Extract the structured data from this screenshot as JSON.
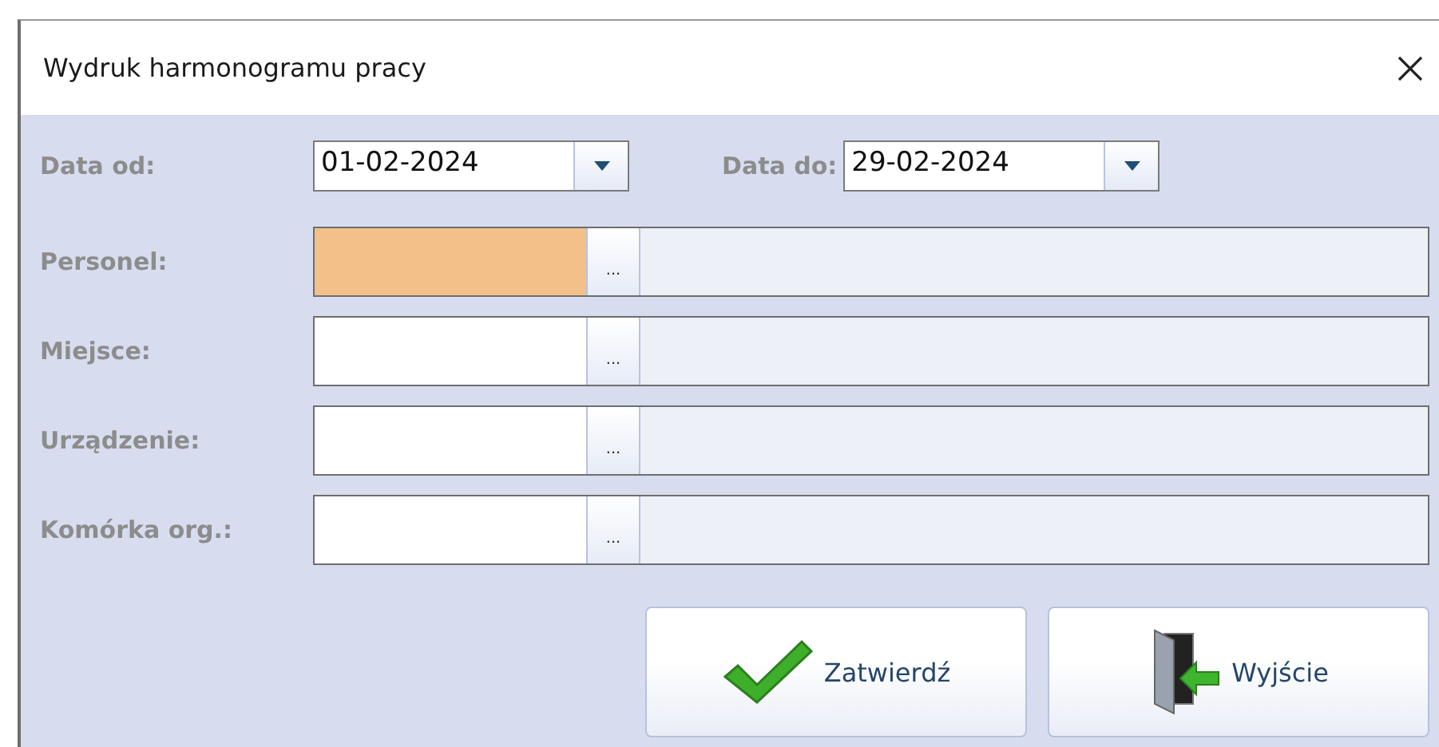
{
  "window": {
    "title": "Wydruk harmonogramu pracy"
  },
  "dates": [
    {
      "label": "Data od:",
      "value": "01-02-2024"
    },
    {
      "label": "Data do:",
      "value": "29-02-2024"
    }
  ],
  "fields": [
    {
      "label": "Personel:",
      "focused": true,
      "browse": "..."
    },
    {
      "label": "Miejsce:",
      "focused": false,
      "browse": "..."
    },
    {
      "label": "Urządzenie:",
      "focused": false,
      "browse": "..."
    },
    {
      "label": "Komórka org.:",
      "focused": false,
      "browse": "..."
    }
  ],
  "buttons": [
    {
      "kind": "confirm",
      "label": "Zatwierdź"
    },
    {
      "kind": "exit",
      "label": "Wyjście"
    }
  ]
}
